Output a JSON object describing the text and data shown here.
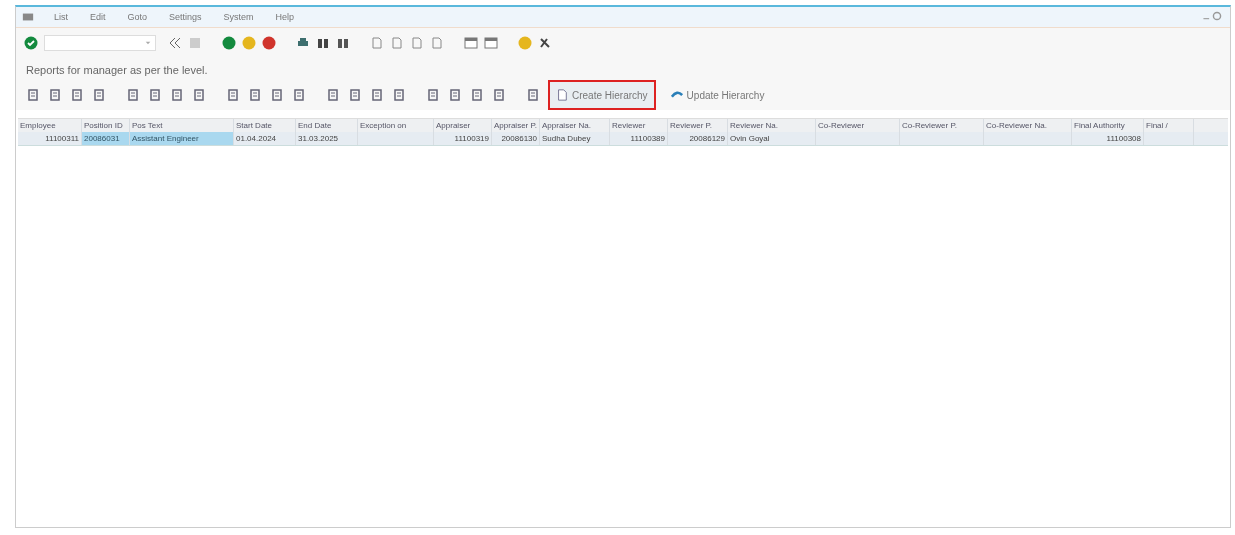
{
  "menu": [
    "List",
    "Edit",
    "Goto",
    "Settings",
    "System",
    "Help"
  ],
  "title": "Reports for manager as per the level.",
  "app_buttons": [
    {
      "label": "Create Hierarchy",
      "highlighted": true,
      "kind": "create"
    },
    {
      "label": "Update Hierarchy",
      "highlighted": false,
      "kind": "update"
    }
  ],
  "table": {
    "columns": [
      "Employee",
      "Position ID",
      "Pos Text",
      "Start Date",
      "End Date",
      "Exception on",
      "Appraiser",
      "Appraiser P.",
      "Appraiser Na.",
      "Reviewer",
      "Reviewer P.",
      "Reviewer Na.",
      "Co-Reviewer",
      "Co-Reviewer P.",
      "Co-Reviewer Na.",
      "Final Authority",
      "Final /"
    ],
    "rows": [
      {
        "cells": [
          {
            "text": "11100311",
            "selected": false
          },
          {
            "text": "20086031",
            "selected": true
          },
          {
            "text": "Assistant Engineer",
            "selected": true
          },
          {
            "text": "01.04.2024",
            "selected": false
          },
          {
            "text": "31.03.2025",
            "selected": false
          },
          {
            "text": "",
            "selected": false
          },
          {
            "text": "11100319",
            "selected": false
          },
          {
            "text": "20086130",
            "selected": false
          },
          {
            "text": "Sudha Dubey",
            "selected": false
          },
          {
            "text": "11100389",
            "selected": false
          },
          {
            "text": "20086129",
            "selected": false
          },
          {
            "text": "Ovin Goyal",
            "selected": false
          },
          {
            "text": "",
            "selected": false
          },
          {
            "text": "",
            "selected": false
          },
          {
            "text": "",
            "selected": false
          },
          {
            "text": "11100308",
            "selected": false
          },
          {
            "text": "",
            "selected": false
          }
        ]
      }
    ]
  }
}
